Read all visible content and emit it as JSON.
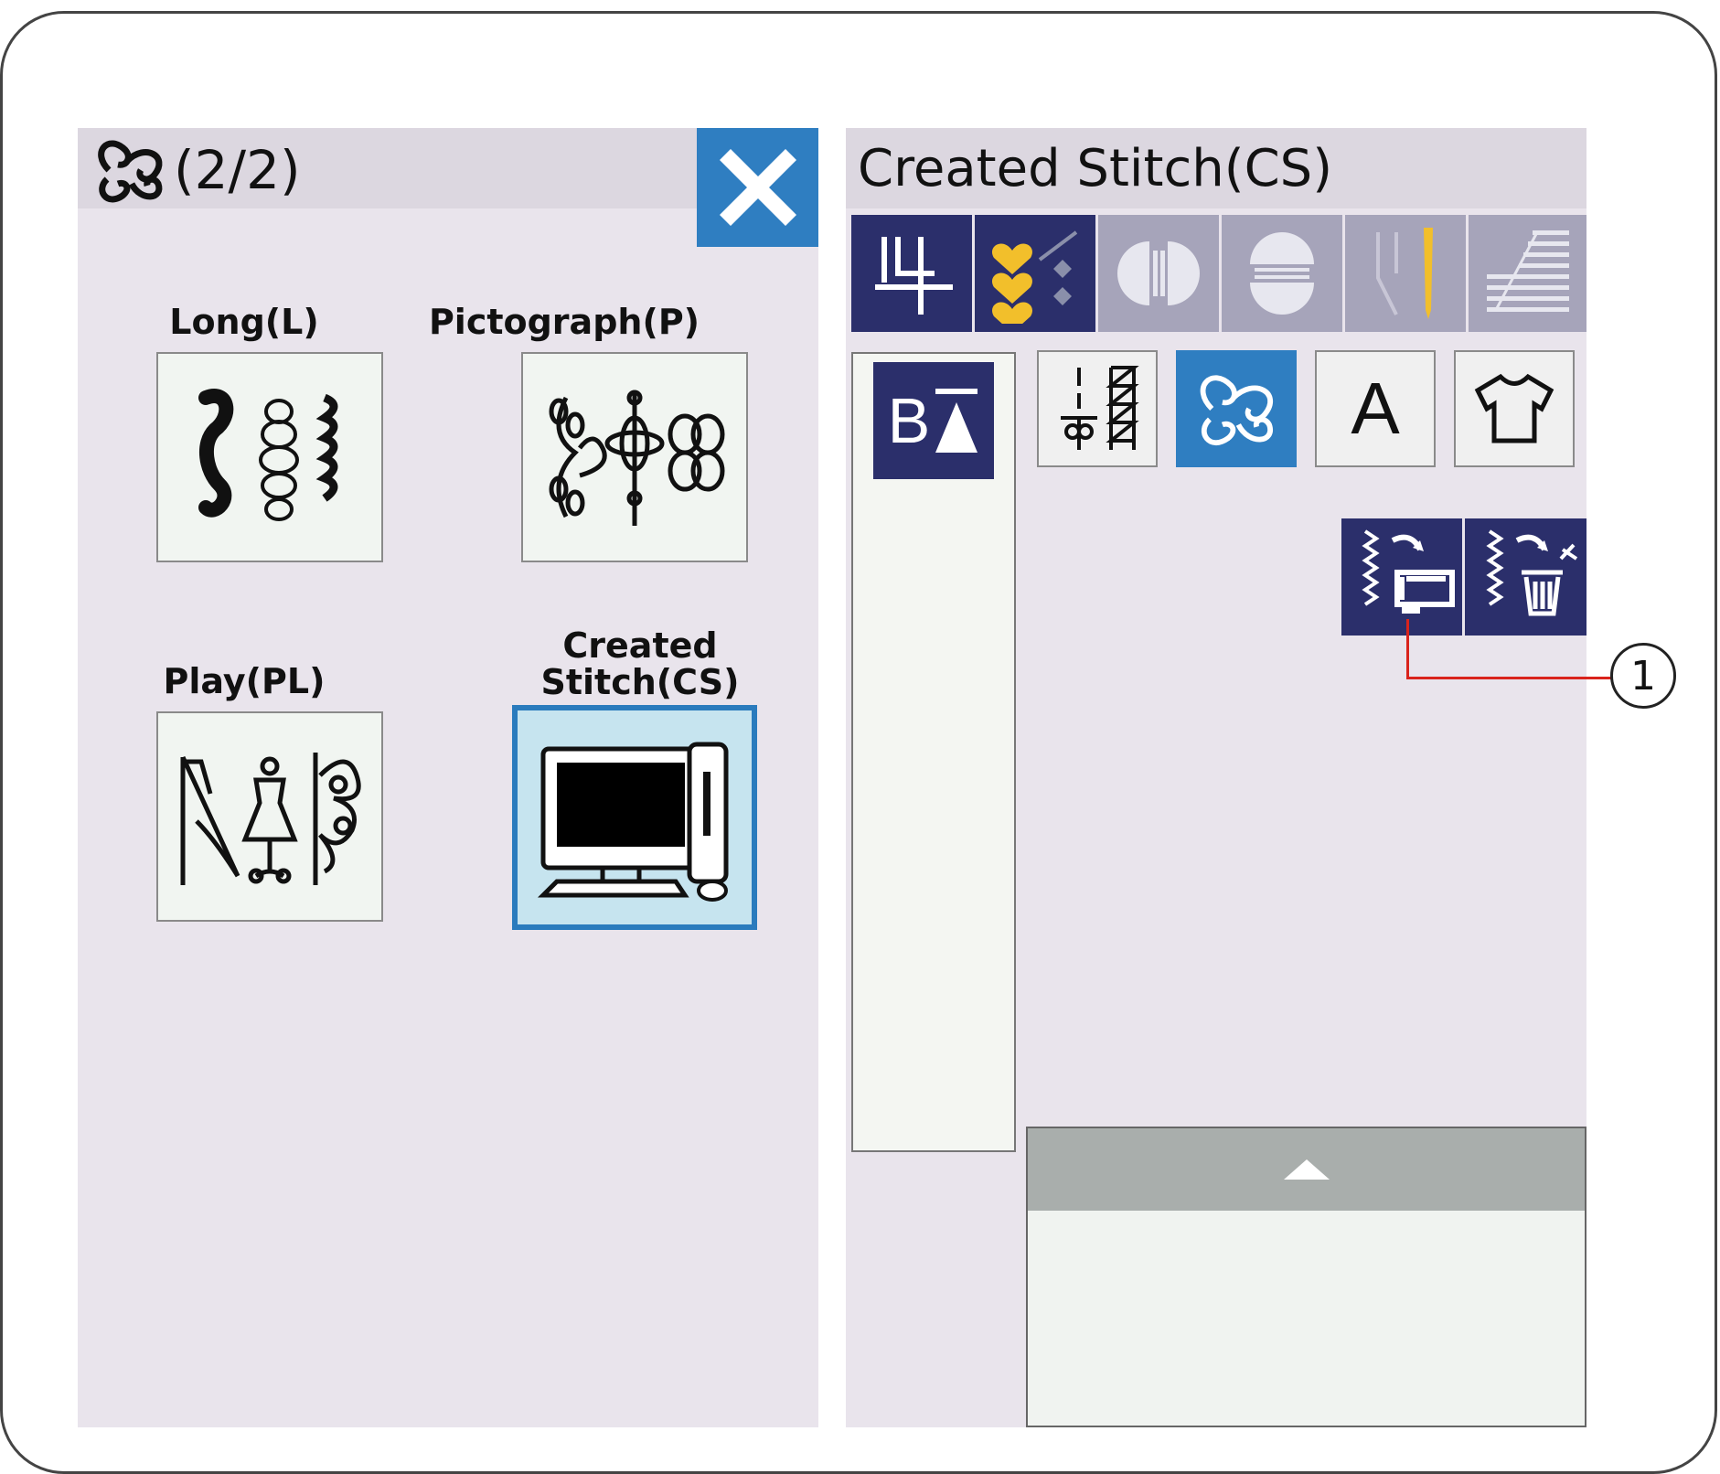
{
  "left_panel": {
    "header_page": "(2/2)",
    "categories": [
      {
        "label": "Long(L)"
      },
      {
        "label": "Pictograph(P)"
      },
      {
        "label": "Play(PL)"
      },
      {
        "label": "Created\nStitch(CS)"
      }
    ]
  },
  "right_panel": {
    "title": "Created Stitch(CS)",
    "letter_button": "A",
    "bz_label": "B"
  },
  "callout": {
    "number": "1"
  },
  "colors": {
    "accent_blue": "#2f7ec1",
    "navy": "#2b2f6b",
    "panel_bg": "#e9e4ec",
    "callout_red": "#d9231c"
  }
}
